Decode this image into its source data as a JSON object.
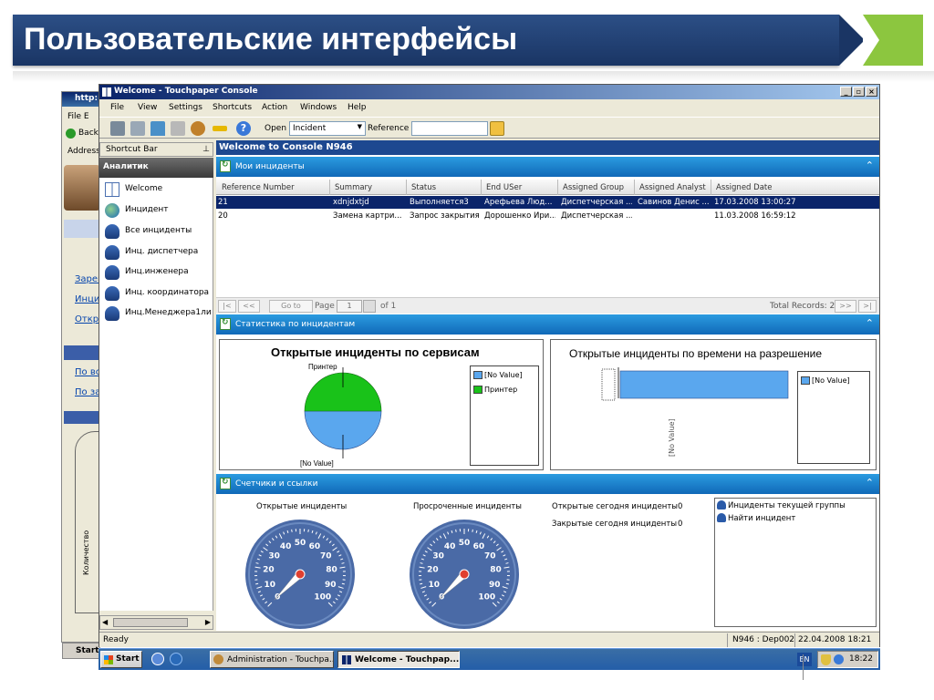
{
  "slide": {
    "title": "Пользовательские интерфейсы"
  },
  "background_window": {
    "title_fragment": "http:",
    "menu_fragment": "File  E",
    "back_label": "Back",
    "address_label": "Address",
    "links": [
      "Зарег",
      "Инци",
      "Откр",
      "По вс",
      "По за"
    ],
    "axis_label": "Количество",
    "task_label": "Start"
  },
  "window": {
    "title": "Welcome - Touchpaper Console",
    "menu": [
      "File",
      "View",
      "Settings",
      "Shortcuts",
      "Action",
      "Windows",
      "Help"
    ],
    "toolbar": {
      "open_label": "Open",
      "open_value": "Incident",
      "reference_label": "Reference",
      "reference_value": ""
    }
  },
  "sidebar": {
    "shortcut_bar_label": "Shortcut Bar",
    "group_title": "Аналитик",
    "items": [
      {
        "label": "Welcome",
        "icon": "grid-icon"
      },
      {
        "label": "Инцидент",
        "icon": "globe-icon"
      },
      {
        "label": "Все инциденты",
        "icon": "user-search-icon"
      },
      {
        "label": "Инц. диспетчера",
        "icon": "user-search-icon"
      },
      {
        "label": "Инц.инженера",
        "icon": "user-search-icon"
      },
      {
        "label": "Инц. координатора",
        "icon": "user-search-icon"
      },
      {
        "label": "Инц.Менеджера1ли",
        "icon": "user-search-icon"
      }
    ]
  },
  "console": {
    "header": "Welcome to Console N946",
    "my_incidents": {
      "title": "Мои инциденты",
      "columns": [
        "Reference Number",
        "Summary",
        "Status",
        "End USer",
        "Assigned Group",
        "Assigned Analyst",
        "Assigned Date"
      ],
      "rows": [
        [
          "21",
          "xdnjdxtjd",
          "Выполняется3",
          "Арефьева Люд...",
          "Диспетчерская ...",
          "Савинов Денис ...",
          "17.03.2008 13:00:27"
        ],
        [
          "20",
          "Замена картри...",
          "Запрос закрытия",
          "Дорошенко Ири...",
          "Диспетчерская ...",
          "",
          "11.03.2008 16:59:12"
        ]
      ],
      "pager": {
        "first": "|<",
        "prev": "<<",
        "goto": "Go to",
        "page_label": "Page",
        "page_value": "1",
        "of_label": "of 1",
        "total": "Total Records: 2",
        "next": ">>",
        "last": ">|"
      }
    },
    "stats": {
      "title": "Статистика по инцидентам",
      "pie_title": "Открытые инциденты по сервисам",
      "pie_labels": [
        "Принтер",
        "[No Value]"
      ],
      "bar_title": "Открытые инциденты по времени на разрешение",
      "bar_axis_label": "[No Value]"
    },
    "counters": {
      "title": "Счетчики и ссылки",
      "gauge1_title": "Открытые инциденты",
      "gauge2_title": "Просроченные инциденты",
      "today_open_label": "Открытые сегодня инциденты",
      "today_open_value": "0",
      "today_closed_label": "Закрытые сегодня инциденты",
      "today_closed_value": "0",
      "links": [
        "Инциденты текущей группы",
        "Найти инцидент"
      ],
      "gauge_ticks": [
        "0",
        "10",
        "20",
        "30",
        "40",
        "50",
        "60",
        "70",
        "80",
        "90",
        "100"
      ]
    }
  },
  "statusbar": {
    "status": "Ready",
    "server": "N946 : Dep002",
    "datetime": "22.04.2008 18:21"
  },
  "taskbar": {
    "start": "Start",
    "tasks": [
      "Administration - Touchpa...",
      "Welcome - Touchpap..."
    ],
    "lang": "EN",
    "clock": "18:22"
  },
  "chart_data": [
    {
      "type": "pie",
      "title": "Открытые инциденты по сервисам",
      "categories": [
        "[No Value]",
        "Принтер"
      ],
      "values": [
        50,
        50
      ],
      "colors": [
        "#5aa7ee",
        "#19c219"
      ],
      "legend": "right"
    },
    {
      "type": "bar",
      "title": "Открытые инциденты по времени на разрешение",
      "categories": [
        "[No Value]"
      ],
      "series": [
        {
          "name": "[No Value]",
          "values": [
            1
          ]
        }
      ],
      "colors": [
        "#5aa7ee"
      ],
      "orientation": "horizontal",
      "legend": "right"
    }
  ]
}
